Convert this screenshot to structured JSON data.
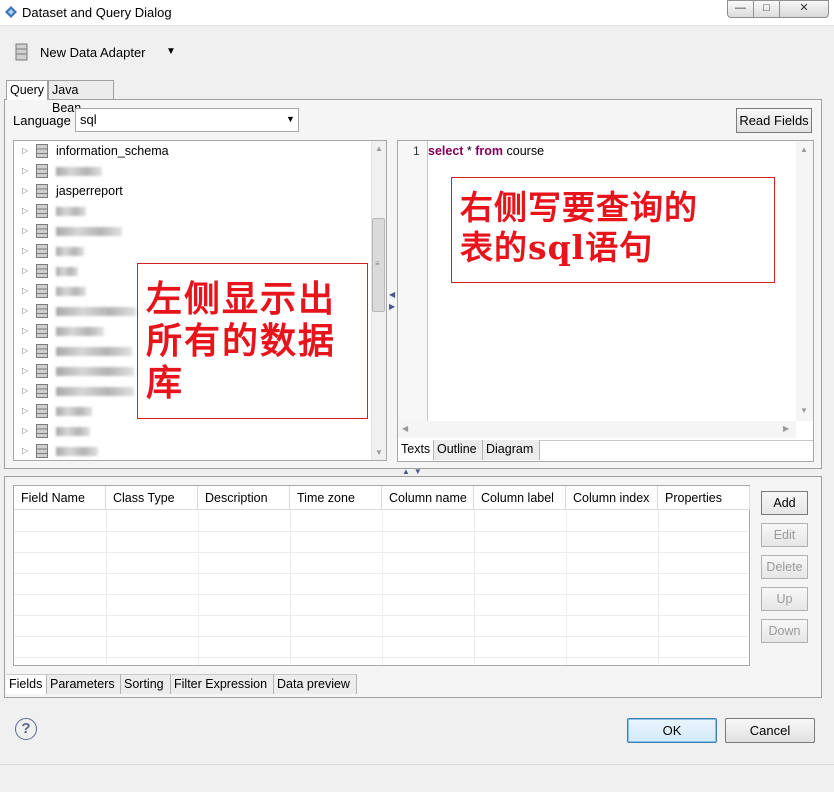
{
  "window": {
    "title": "Dataset and Query Dialog",
    "minimize_glyph": "—",
    "maximize_glyph": "□",
    "close_glyph": "✕"
  },
  "adapter": {
    "label": "New Data Adapter",
    "dropdown_glyph": "▼",
    "icon": "database-icon"
  },
  "query_tabs": [
    {
      "label": "Query",
      "active": true
    },
    {
      "label": "Java Bean",
      "active": false
    }
  ],
  "language": {
    "label": "Language",
    "value": "sql",
    "arrow": "▼"
  },
  "read_fields_label": "Read Fields",
  "db_tree": {
    "expander": "▷",
    "items": [
      {
        "label": "information_schema",
        "blurred": false
      },
      {
        "label": "",
        "blurred": true,
        "blur_width": 46
      },
      {
        "label": "jasperreport",
        "blurred": false
      },
      {
        "label": "",
        "blurred": true,
        "blur_width": 30
      },
      {
        "label": "",
        "blurred": true,
        "blur_width": 66
      },
      {
        "label": "",
        "blurred": true,
        "blur_width": 28
      },
      {
        "label": "",
        "blurred": true,
        "blur_width": 22
      },
      {
        "label": "",
        "blurred": true,
        "blur_width": 30
      },
      {
        "label": "",
        "blurred": true,
        "blur_width": 80
      },
      {
        "label": "",
        "blurred": true,
        "blur_width": 48
      },
      {
        "label": "",
        "blurred": true,
        "blur_width": 76
      },
      {
        "label": "",
        "blurred": true,
        "blur_width": 78
      },
      {
        "label": "",
        "blurred": true,
        "blur_width": 78
      },
      {
        "label": "",
        "blurred": true,
        "blur_width": 36
      },
      {
        "label": "",
        "blurred": true,
        "blur_width": 34
      },
      {
        "label": "",
        "blurred": true,
        "blur_width": 42
      }
    ]
  },
  "editor": {
    "line_number": "1",
    "sql": {
      "kw1": "select",
      "mid": " * ",
      "kw2": "from",
      "rest": " course"
    },
    "tabs": [
      {
        "label": "Texts",
        "active": true
      },
      {
        "label": "Outline",
        "active": false
      },
      {
        "label": "Diagram",
        "active": false
      }
    ]
  },
  "annotations": {
    "left_line1": "左侧显示出",
    "left_line2": "所有的数据",
    "left_line3": "库",
    "right_line1": "右侧写要查询的",
    "right_line2": "表的sql语句",
    "color": "#e8141b"
  },
  "fields_table": {
    "columns": [
      "Field Name",
      "Class Type",
      "Description",
      "Time zone",
      "Column name",
      "Column label",
      "Column index",
      "Properties"
    ]
  },
  "side_buttons": {
    "add": "Add",
    "edit": "Edit",
    "delete": "Delete",
    "up": "Up",
    "down": "Down"
  },
  "bottom_tabs": [
    {
      "label": "Fields",
      "active": true
    },
    {
      "label": "Parameters",
      "active": false
    },
    {
      "label": "Sorting",
      "active": false
    },
    {
      "label": "Filter Expression",
      "active": false
    },
    {
      "label": "Data preview",
      "active": false
    }
  ],
  "dialog_buttons": {
    "help": "?",
    "ok": "OK",
    "cancel": "Cancel"
  }
}
